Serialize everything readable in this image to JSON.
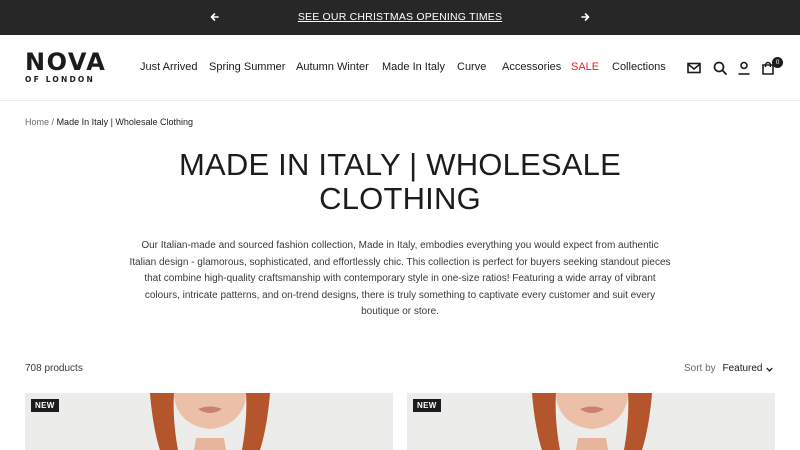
{
  "announcement": {
    "text": "SEE OUR CHRISTMAS OPENING TIMES"
  },
  "logo": {
    "brand": "NOVA",
    "sub": "OF LONDON"
  },
  "nav": [
    {
      "label": "Just Arrived"
    },
    {
      "label": "Spring Summer"
    },
    {
      "label": "Autumn Winter"
    },
    {
      "label": "Made In Italy"
    },
    {
      "label": "Curve"
    },
    {
      "label": "Accessories"
    },
    {
      "label": "SALE"
    },
    {
      "label": "Collections"
    }
  ],
  "cart": {
    "count": "0"
  },
  "breadcrumb": {
    "home": "Home",
    "separator": "/",
    "current": "Made In Italy | Wholesale Clothing"
  },
  "page": {
    "title": "MADE IN ITALY | WHOLESALE CLOTHING",
    "description": "Our Italian-made and sourced fashion collection, Made in Italy, embodies everything you would expect from authentic Italian design - glamorous, sophisticated, and effortlessly chic. This collection is perfect for buyers seeking standout pieces that combine high-quality craftsmanship with contemporary style in one-size ratios! Featuring a wide array of vibrant colours, intricate patterns, and on-trend designs, there is truly something to captivate every customer and suit every boutique or store."
  },
  "listing": {
    "count": "708 products",
    "sort_label": "Sort by",
    "sort_value": "Featured"
  },
  "products": [
    {
      "badge": "NEW"
    },
    {
      "badge": "NEW"
    }
  ],
  "colors": {
    "announcement_bg": "#272727",
    "sale": "#e3221b",
    "text": "#1c1c1c"
  },
  "icons": [
    "arrow-left-icon",
    "arrow-right-icon",
    "mail-icon",
    "search-icon",
    "account-icon",
    "cart-icon",
    "chevron-down-icon"
  ]
}
